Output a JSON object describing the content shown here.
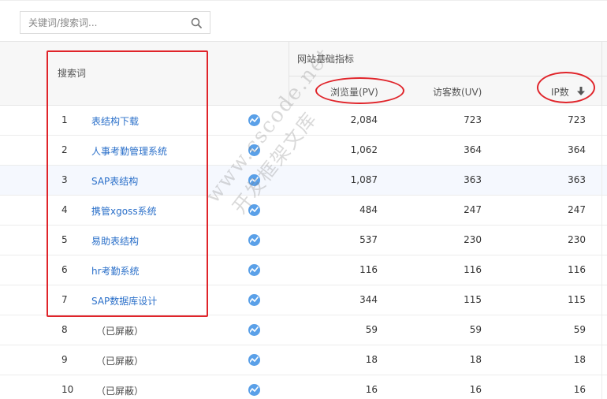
{
  "search": {
    "placeholder": "关键词/搜索词..."
  },
  "table": {
    "col_keyword": "搜索词",
    "group_label": "网站基础指标",
    "col_pv": "浏览量(PV)",
    "col_uv": "访客数(UV)",
    "col_ip": "IP数",
    "sort": "descending"
  },
  "rows": [
    {
      "no": "1",
      "kw": "表结构下载",
      "pv": "2,084",
      "uv": "723",
      "ip": "723"
    },
    {
      "no": "2",
      "kw": "人事考勤管理系统",
      "pv": "1,062",
      "uv": "364",
      "ip": "364"
    },
    {
      "no": "3",
      "kw": "SAP表结构",
      "pv": "1,087",
      "uv": "363",
      "ip": "363"
    },
    {
      "no": "4",
      "kw": "携管xgoss系统",
      "pv": "484",
      "uv": "247",
      "ip": "247"
    },
    {
      "no": "5",
      "kw": "易助表结构",
      "pv": "537",
      "uv": "230",
      "ip": "230"
    },
    {
      "no": "6",
      "kw": "hr考勤系统",
      "pv": "116",
      "uv": "116",
      "ip": "116"
    },
    {
      "no": "7",
      "kw": "SAP数据库设计",
      "pv": "344",
      "uv": "115",
      "ip": "115"
    },
    {
      "no": "8",
      "kw": "（已屏蔽）",
      "pv": "59",
      "uv": "59",
      "ip": "59"
    },
    {
      "no": "9",
      "kw": "（已屏蔽）",
      "pv": "18",
      "uv": "18",
      "ip": "18"
    },
    {
      "no": "10",
      "kw": "（已屏蔽）",
      "pv": "16",
      "uv": "16",
      "ip": "16"
    }
  ],
  "watermark": {
    "line1": "www.cscode.net",
    "line2": "开发框架文库"
  },
  "colors": {
    "link": "#2a6fc9",
    "annotation": "#e0242a",
    "trend_icon": "#5aa0e8",
    "highlight_row": "#f5f8fe"
  }
}
